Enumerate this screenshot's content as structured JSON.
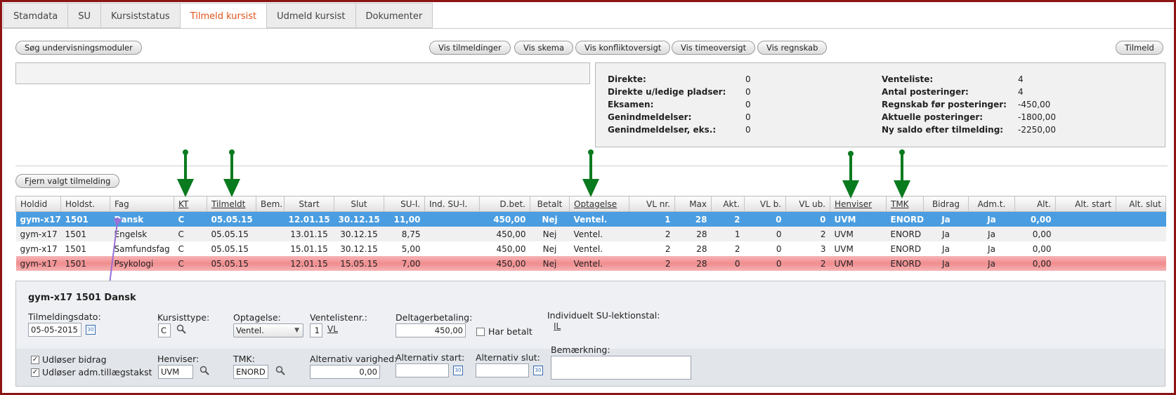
{
  "tabs": [
    "Stamdata",
    "SU",
    "Kursiststatus",
    "Tilmeld kursist",
    "Udmeld kursist",
    "Dokumenter"
  ],
  "toolbar": {
    "search_modules": "Søg undervisningsmoduler",
    "show_enrollments": "Vis tilmeldinger",
    "show_schedule": "Vis skema",
    "show_conflicts": "Vis konfliktoversigt",
    "show_hours": "Vis timeoversigt",
    "show_accounts": "Vis regnskab",
    "enroll": "Tilmeld"
  },
  "stats_left": [
    {
      "label": "Direkte:",
      "value": "0"
    },
    {
      "label": "Direkte u/ledige pladser:",
      "value": "0"
    },
    {
      "label": "Eksamen:",
      "value": "0"
    },
    {
      "label": "Genindmeldelser:",
      "value": "0"
    },
    {
      "label": "Genindmeldelser, eks.:",
      "value": "0"
    }
  ],
  "stats_right": [
    {
      "label": "Venteliste:",
      "value": "4"
    },
    {
      "label": "Antal posteringer:",
      "value": "4"
    },
    {
      "label": "Regnskab før posteringer:",
      "value": "-450,00"
    },
    {
      "label": "Aktuelle posteringer:",
      "value": "-1800,00"
    },
    {
      "label": "Ny saldo efter tilmelding:",
      "value": "-2250,00"
    }
  ],
  "remove_button": "Fjern valgt tilmelding",
  "table": {
    "headers": [
      "Holdid",
      "Holdst.",
      "Fag",
      "KT",
      "Tilmeldt",
      "Bem.",
      "Start",
      "Slut",
      "SU-l.",
      "Ind. SU-l.",
      "D.bet.",
      "Betalt",
      "Optagelse",
      "VL nr.",
      "Max",
      "Akt.",
      "VL b.",
      "VL ub.",
      "Henviser",
      "TMK",
      "Bidrag",
      "Adm.t.",
      "Alt.",
      "Alt. start",
      "Alt. slut"
    ],
    "rows": [
      [
        "gym-x17",
        "1501",
        "Dansk",
        "C",
        "05.05.15",
        "",
        "12.01.15",
        "30.12.15",
        "11,00",
        "",
        "450,00",
        "Nej",
        "Ventel.",
        "1",
        "28",
        "2",
        "0",
        "0",
        "UVM",
        "ENORD",
        "Ja",
        "Ja",
        "0,00",
        "",
        ""
      ],
      [
        "gym-x17",
        "1501",
        "Engelsk",
        "C",
        "05.05.15",
        "",
        "13.01.15",
        "30.12.15",
        "8,75",
        "",
        "450,00",
        "Nej",
        "Ventel.",
        "2",
        "28",
        "1",
        "0",
        "2",
        "UVM",
        "ENORD",
        "Ja",
        "Ja",
        "0,00",
        "",
        ""
      ],
      [
        "gym-x17",
        "1501",
        "Samfundsfag",
        "C",
        "05.05.15",
        "",
        "15.01.15",
        "30.12.15",
        "5,00",
        "",
        "450,00",
        "Nej",
        "Ventel.",
        "2",
        "28",
        "2",
        "0",
        "3",
        "UVM",
        "ENORD",
        "Ja",
        "Ja",
        "0,00",
        "",
        ""
      ],
      [
        "gym-x17",
        "1501",
        "Psykologi",
        "C",
        "05.05.15",
        "",
        "12.01.15",
        "15.05.15",
        "7,00",
        "",
        "450,00",
        "Nej",
        "Ventel.",
        "2",
        "28",
        "0",
        "0",
        "2",
        "UVM",
        "ENORD",
        "Ja",
        "Ja",
        "0,00",
        "",
        ""
      ]
    ]
  },
  "detail": {
    "title": "gym-x17 1501 Dansk",
    "enroll_date_label": "Tilmeldingsdato:",
    "enroll_date": "05-05-2015",
    "course_type_label": "Kursisttype:",
    "course_type": "C",
    "admission_label": "Optagelse:",
    "admission": "Ventel.",
    "waitlist_label": "Ventelistenr.:",
    "waitlist_no": "1",
    "waitlist_link": "VL",
    "fee_label": "Deltagerbetaling:",
    "fee": "450,00",
    "has_paid": "Har betalt",
    "su_label": "Individuelt SU-lektionstal:",
    "su_link": "IL",
    "triggers_grant": "Udløser bidrag",
    "triggers_admin": "Udløser adm.tillægstakst",
    "referrer_label": "Henviser:",
    "referrer": "UVM",
    "tmk_label": "TMK:",
    "tmk": "ENORD",
    "alt_duration_label": "Alternativ varighed:",
    "alt_duration": "0,00",
    "alt_start_label": "Alternativ start:",
    "alt_start": "",
    "alt_end_label": "Alternativ slut:",
    "alt_end": "",
    "remark_label": "Bemærkning:",
    "remark": "",
    "calendar_glyph": "30"
  },
  "colors": {
    "accent": "#e0531c",
    "selected_row": "#4a9de0",
    "error_row": "#f08c8e",
    "arrow_green": "#0a7a1e",
    "arrow_purple": "#9a6fd6",
    "frame": "#8b1414"
  }
}
